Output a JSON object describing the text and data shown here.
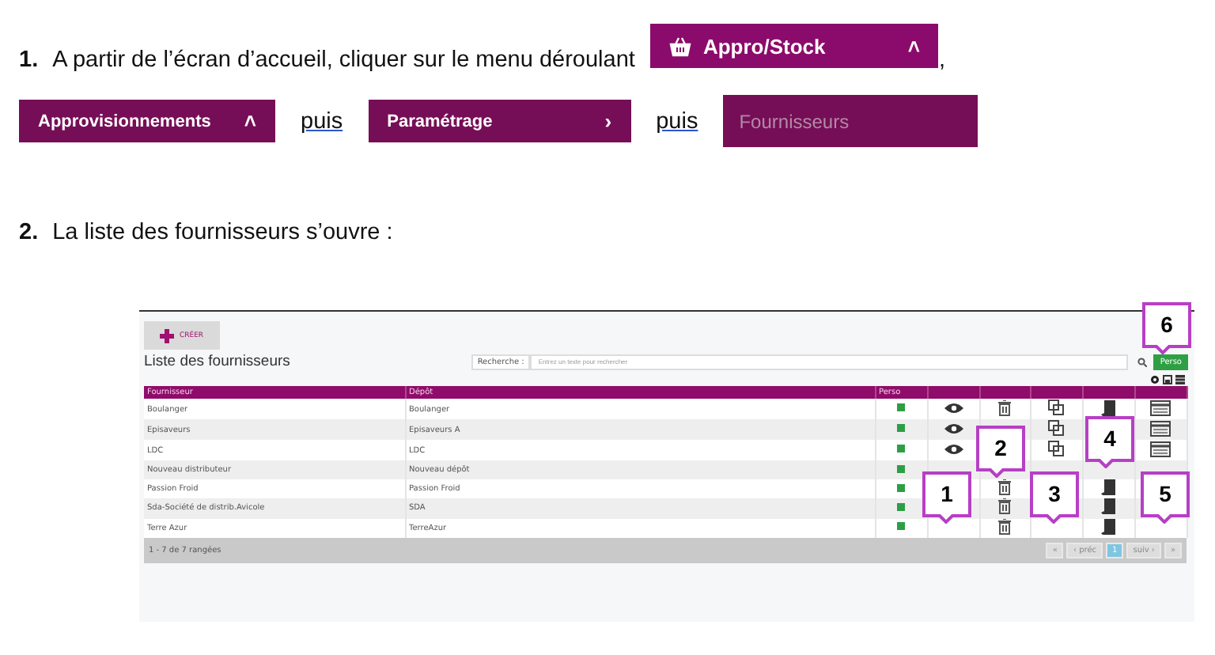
{
  "step_1": {
    "number": "1.",
    "parts": [
      {
        "kind": "text",
        "text": "A partir de l’écran d’accueil, cliquer sur le menu déroulant"
      },
      {
        "kind": "menu-header",
        "label": "Appro/Stock",
        "chevron": "˄"
      },
      {
        "kind": "text",
        "text": ","
      },
      {
        "kind": "menu-sub",
        "label": "Approvisionnements",
        "chevron": "˄"
      },
      {
        "kind": "link",
        "text": "puis"
      },
      {
        "kind": "menu-sub",
        "label": "Paramétrage",
        "chevron": "›"
      },
      {
        "kind": "link",
        "text": "puis"
      },
      {
        "kind": "menu-item",
        "label": "Fournisseurs"
      }
    ]
  },
  "step_2": {
    "number": "2.",
    "text": "La liste des fournisseurs s’ouvre :"
  },
  "screenshot": {
    "create_button": "CRÉER",
    "title": "Liste des fournisseurs",
    "search": {
      "label": "Recherche :",
      "placeholder": "Entrez un texte pour rechercher"
    },
    "perso_button": "Perso",
    "columns": [
      "Fournisseur",
      "Dépôt",
      "Perso"
    ],
    "rows": [
      {
        "supplier": "Boulanger",
        "depot": "Boulanger",
        "perso": true
      },
      {
        "supplier": "Episaveurs",
        "depot": "Episaveurs A",
        "perso": true
      },
      {
        "supplier": "LDC",
        "depot": "LDC",
        "perso": true
      },
      {
        "supplier": "Nouveau distributeur",
        "depot": "Nouveau dépôt",
        "perso": true
      },
      {
        "supplier": "Passion Froid",
        "depot": "Passion Froid",
        "perso": true
      },
      {
        "supplier": "Sda-Société de distrib.Avicole",
        "depot": "SDA",
        "perso": true
      },
      {
        "supplier": "Terre Azur",
        "depot": "TerreAzur",
        "perso": true
      }
    ],
    "footer": "1 - 7 de 7 rangées",
    "pagination": [
      {
        "label": "«",
        "selected": false
      },
      {
        "label": "‹ préc",
        "selected": false
      },
      {
        "label": "1",
        "selected": true
      },
      {
        "label": "suiv ›",
        "selected": false
      },
      {
        "label": "»",
        "selected": false
      }
    ],
    "callouts": [
      "1",
      "2",
      "3",
      "4",
      "5",
      "6"
    ]
  }
}
